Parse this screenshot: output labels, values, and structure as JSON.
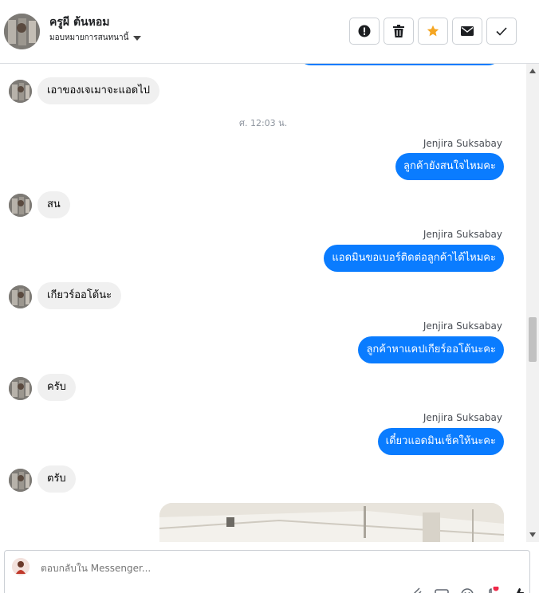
{
  "header": {
    "name": "ครูผี ต้นหอม",
    "assign_label": "มอบหมายการสนทนานี้",
    "actions": [
      "alert-icon",
      "trash-icon",
      "star-icon",
      "mail-icon",
      "check-icon"
    ],
    "star_color": "#f5a623"
  },
  "messages": {
    "in_1": "เอาของเจเมาจะแอดไป",
    "timestamp": "ศ. 12:03 น.",
    "sender_1": "Jenjira Suksabay",
    "out_1": "ลูกค้ายังสนใจไหมคะ",
    "in_2": "สน",
    "sender_2": "Jenjira Suksabay",
    "out_2": "แอดมินขอเบอร์ติดต่อลูกค้าได้ไหมคะ",
    "in_3": "เกียวร์ออโต้นะ",
    "sender_3": "Jenjira Suksabay",
    "out_3": "ลูกค้าหาแคปเกียร์ออโต้นะคะ",
    "in_4": "ครับ",
    "sender_4": "Jenjira Suksabay",
    "out_4": "เดี๋ยวแอดมินเช็คให้นะคะ",
    "in_5": "ตรับ"
  },
  "composer": {
    "placeholder": "ตอบกลับใน Messenger...",
    "icons": [
      "attach-icon",
      "gif-icon",
      "emoji-icon",
      "sticker-icon",
      "like-icon"
    ]
  },
  "colors": {
    "accent": "#0a7cff",
    "incoming_bubble": "#f0f0f0"
  }
}
